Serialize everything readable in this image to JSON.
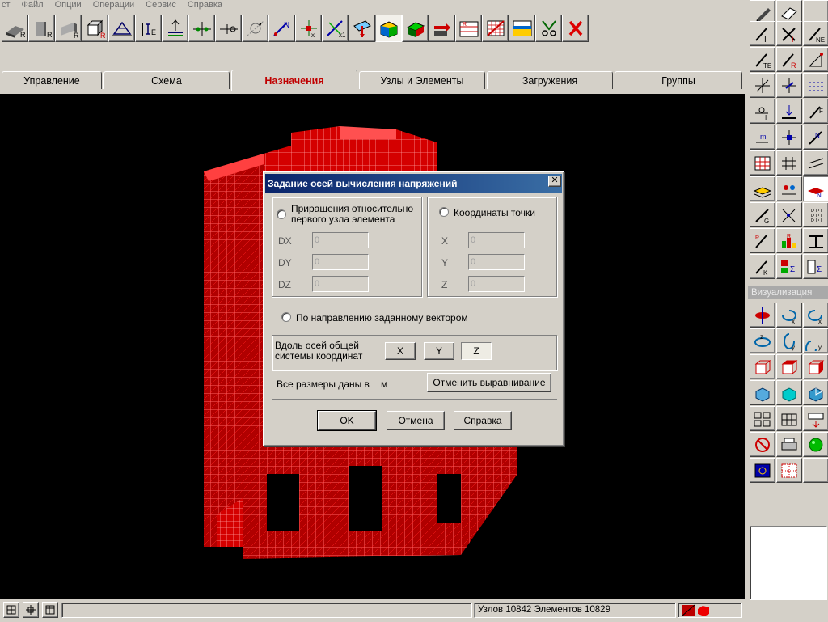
{
  "menu": [
    "ст",
    "Файл",
    "Опции",
    "Операции",
    "Сервис",
    "Справка"
  ],
  "toolbar": {
    "buttons": [
      {
        "icon": "eraser-r-icon"
      },
      {
        "icon": "column-r-icon"
      },
      {
        "icon": "plate-r-icon"
      },
      {
        "icon": "box-r-icon"
      },
      {
        "icon": "truss-icon"
      },
      {
        "icon": "rigid-icon"
      },
      {
        "icon": "support-icon"
      },
      {
        "icon": "hinge-icon"
      },
      {
        "icon": "hinge-alt-icon"
      },
      {
        "icon": "axis-rotate-icon"
      },
      {
        "icon": "node-n-icon"
      },
      {
        "icon": "node-cross-icon"
      },
      {
        "icon": "xy-rotate-icon"
      },
      {
        "icon": "local-axes-icon"
      },
      {
        "icon": "stress-axes-icon"
      },
      {
        "icon": "color-stack-icon"
      },
      {
        "icon": "arrow-stack-icon"
      },
      {
        "icon": "r-table-icon"
      },
      {
        "icon": "grid-red-icon"
      },
      {
        "icon": "yellow-plate-icon"
      },
      {
        "icon": "scissors-icon"
      },
      {
        "icon": "red-x-icon"
      }
    ],
    "pressed_index": 14
  },
  "tabs": {
    "items": [
      "Управление",
      "Схема",
      "Назначения",
      "Узлы и Элементы",
      "Загружения",
      "Группы"
    ],
    "active_index": 2
  },
  "dialog": {
    "title": "Задание осей вычисления напряжений",
    "close_label": "✕",
    "option1_label": "Приращения относительно первого узла элемента",
    "option2_label": "Координаты точки",
    "dx_label": "DX",
    "dy_label": "DY",
    "dz_label": "DZ",
    "x_label": "X",
    "y_label": "Y",
    "z_label": "Z",
    "dx_value": "0",
    "dy_value": "0",
    "dz_value": "0",
    "x_value": "0",
    "y_value": "0",
    "z_value": "0",
    "option3_label": "По направлению заданному вектором",
    "axes_label": "Вдоль осей общей системы координат",
    "axis_x_label": "X",
    "axis_y_label": "Y",
    "axis_z_label": "Z",
    "units_prefix": "Все размеры даны в",
    "units_value": "м",
    "cancel_align_label": "Отменить выравнивание",
    "ok_label": "OK",
    "cancel_label": "Отмена",
    "help_label": "Справка"
  },
  "status": {
    "info": "Узлов 10842 Элементов 10829"
  },
  "right_panel": {
    "section_label": "Визуализация"
  },
  "colors": {
    "mesh": "#ff1a1a",
    "mesh_light": "#ff8080",
    "title_bar": "#0a246a",
    "active_tab_text": "#c00000"
  }
}
